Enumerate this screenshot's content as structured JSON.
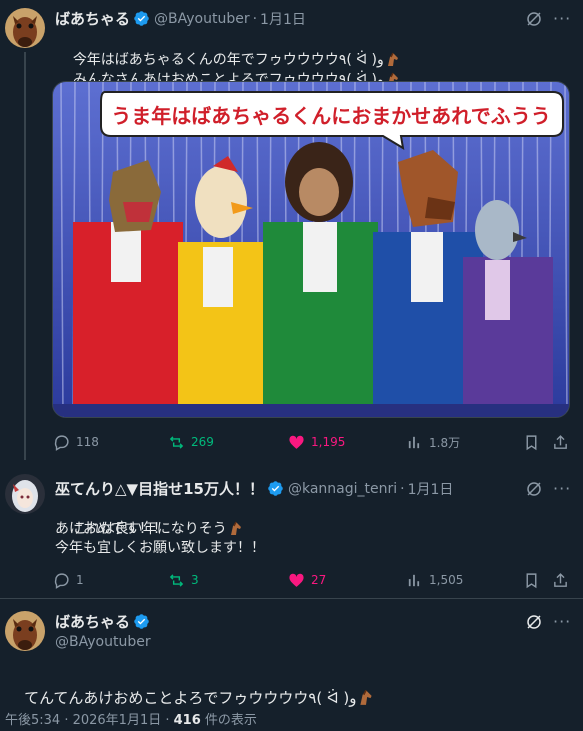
{
  "tweet1": {
    "name": "ばあちゃる",
    "handle": "@BAyoutuber",
    "date": "1月1日",
    "line1": "今年はばあちゃるくんの年でフゥウウウウ٩( ᐛ )و",
    "line2": "みんなさんあけおめことよろでフゥウウウ٩( ᐛ )و",
    "banner_text": "うま年はばあちゃるくんにおまかせあれでふうう",
    "replies": "118",
    "retweets": "269",
    "likes": "1,195",
    "views": "1.8万"
  },
  "tweet2": {
    "name": "巫てんり△▼目指せ15万人！！",
    "handle": "@kannagi_tenri",
    "date": "1月1日",
    "line1": "これは良い年になりそう",
    "line2": "あけおめです！！",
    "line3": "今年も宜しくお願い致します！！",
    "replies": "1",
    "retweets": "3",
    "likes": "27",
    "views": "1,505"
  },
  "tweet3": {
    "name": "ばあちゃる",
    "handle": "@BAyoutuber",
    "text": "てんてんあけおめことよろでフゥウウウウ٩( ᐛ )و",
    "time": "午後5:34 · 2026年1月1日 · ",
    "views_count": "416",
    "views_label": " 件の表示"
  },
  "colors": {
    "background": "#15202b",
    "verified": "#1d9bf0",
    "retweet": "#00ba7c",
    "like": "#f91880",
    "muted": "#8b98a5"
  },
  "icons": [
    "verified-badge-icon",
    "grok-icon",
    "more-icon",
    "reply-icon",
    "retweet-icon",
    "heart-icon",
    "views-icon",
    "bookmark-icon",
    "share-icon",
    "horse-emoji-icon"
  ]
}
